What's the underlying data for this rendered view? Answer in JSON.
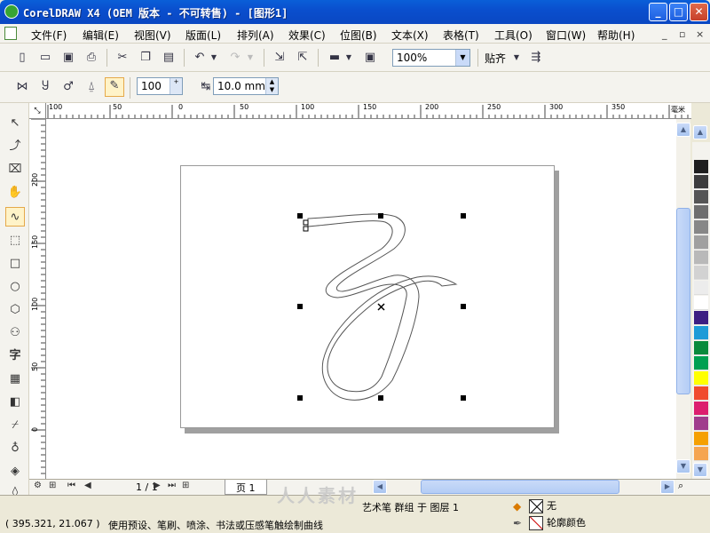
{
  "window": {
    "title": "CorelDRAW X4 (OEM 版本 - 不可转售) - [图形1]",
    "controls": {
      "minimize": "_",
      "maximize": "□",
      "close": "✕"
    }
  },
  "menu": {
    "items": [
      "文件(F)",
      "编辑(E)",
      "视图(V)",
      "版面(L)",
      "排列(A)",
      "效果(C)",
      "位图(B)",
      "文本(X)",
      "表格(T)",
      "工具(O)",
      "窗口(W)",
      "帮助(H)"
    ],
    "doc_controls": [
      "_",
      "▫",
      "×"
    ]
  },
  "toolbar": {
    "zoom_value": "100%",
    "snap_label": "贴齐"
  },
  "property_bar": {
    "smoothing_value": "100",
    "width_value": "10.0 mm"
  },
  "toolbox": {
    "text_tool_glyph": "字"
  },
  "ruler": {
    "horizontal_labels": [
      "100",
      "50",
      "0",
      "50",
      "100",
      "150",
      "200",
      "250",
      "300",
      "350"
    ],
    "unit": "毫米",
    "vertical_labels": [
      "200",
      "150",
      "100",
      "50",
      "0"
    ]
  },
  "palette": {
    "none_glyph": "✕",
    "colors": [
      "#1e1e1e",
      "#3c3c3c",
      "#555555",
      "#6e6e6e",
      "#878787",
      "#a0a0a0",
      "#b9b9b9",
      "#d2d2d2",
      "#ececec",
      "#ffffff",
      "#3c1e82",
      "#1e9bd7",
      "#0a8a3c",
      "#00a050",
      "#ffff00",
      "#f04b2d",
      "#dc1e6e",
      "#a03c8c",
      "#f5a000",
      "#f5a550"
    ]
  },
  "navigator": {
    "page_counter": "1 / 1",
    "page_tab": "页 1"
  },
  "status": {
    "coords": "( 395.321, 21.067 )",
    "hint": "使用预设、笔刷、喷涂、书法或压感笔触绘制曲线",
    "object_info": "艺术笔 群组 于 图层 1",
    "fill_label": "无",
    "outline_label": "轮廓颜色"
  },
  "watermark": "人人素材"
}
